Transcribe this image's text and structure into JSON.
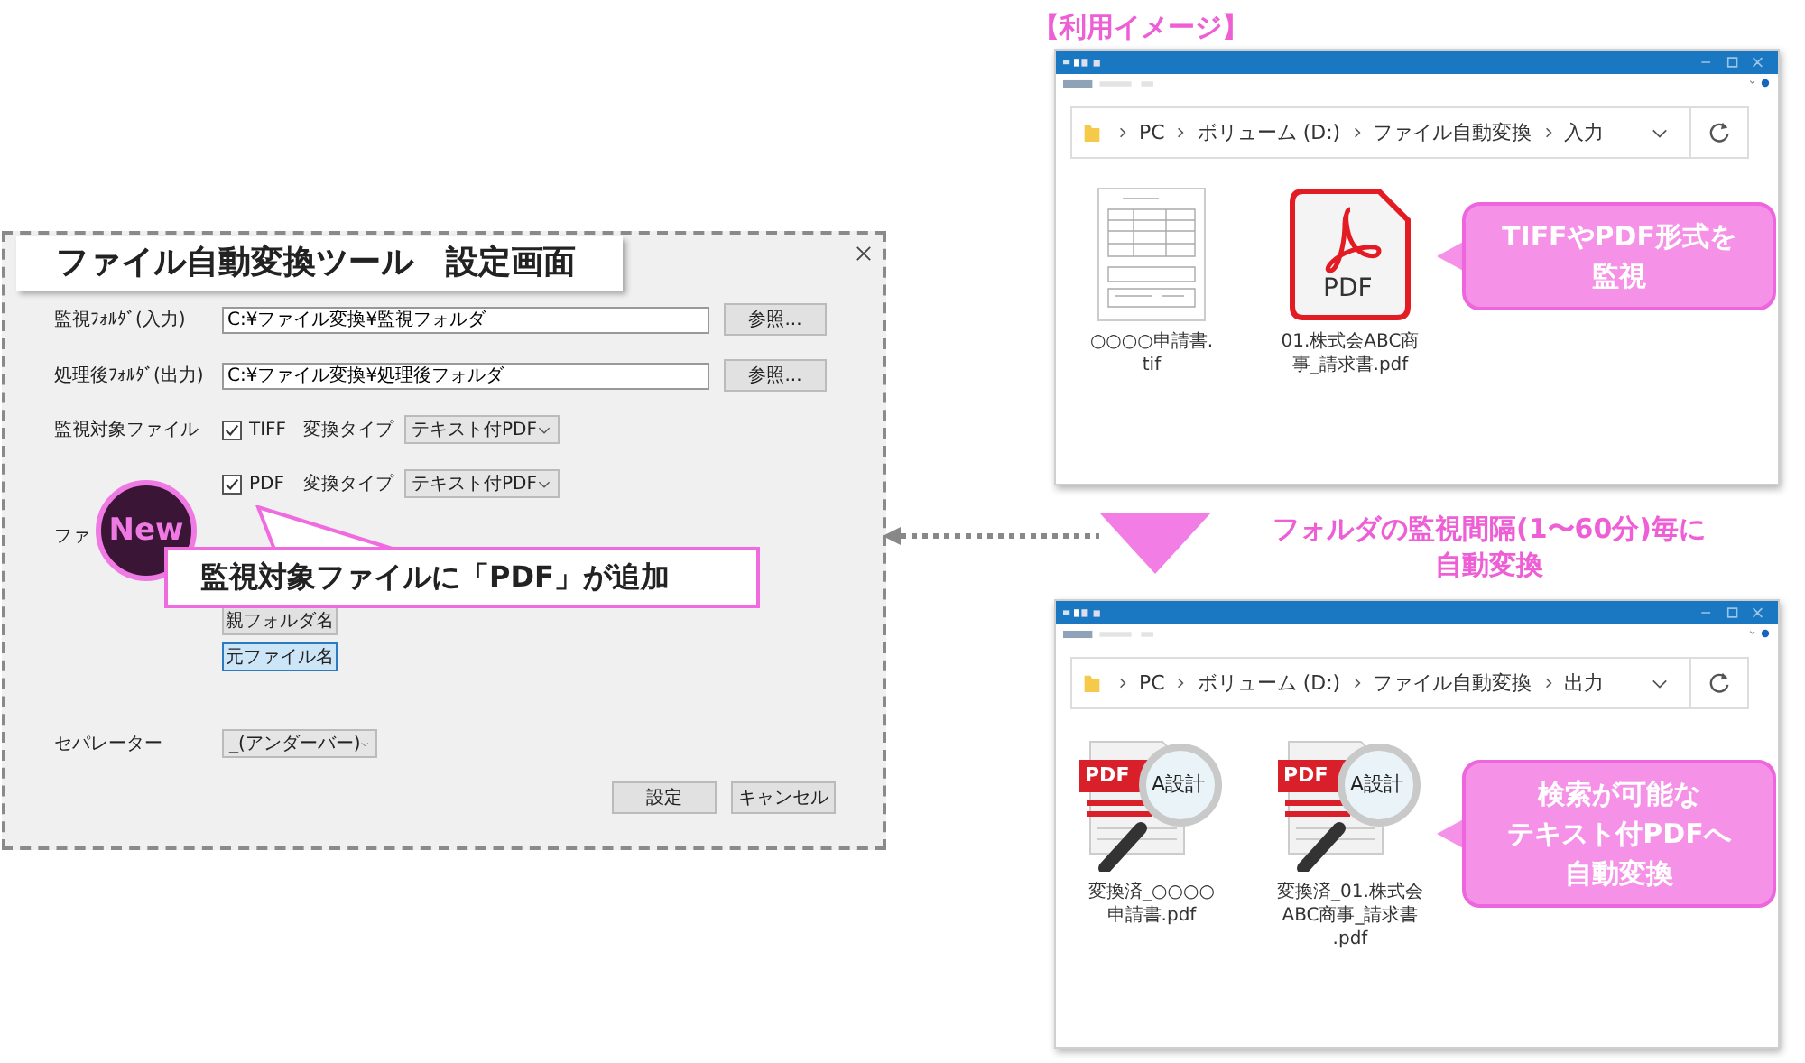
{
  "dialog": {
    "title": "ファイル自動変換ツール　設定画面",
    "input_folder": {
      "label": "監視ﾌｫﾙﾀﾞ(入力)",
      "value": "C:¥ファイル変換¥監視フォルダ",
      "button": "参照..."
    },
    "output_folder": {
      "label": "処理後ﾌｫﾙﾀﾞ(出力)",
      "value": "C:¥ファイル変換¥処理後フォルダ",
      "button": "参照..."
    },
    "target_files": {
      "label": "監視対象ファイル",
      "items": [
        {
          "name": "TIFF",
          "checked": true,
          "type_label": "変換タイプ",
          "type_value": "テキスト付PDF"
        },
        {
          "name": "PDF",
          "checked": true,
          "type_label": "変換タイプ",
          "type_value": "テキスト付PDF"
        }
      ]
    },
    "filename_label": "ファ",
    "name_buttons": [
      {
        "label": "親フォルダ名",
        "selected": false
      },
      {
        "label": "元ファイル名",
        "selected": true
      }
    ],
    "separator": {
      "label": "セパレーター",
      "value": "_(アンダーバー)"
    },
    "buttons": [
      "設定",
      "キャンセル"
    ]
  },
  "new_badge": "New",
  "callout": "監視対象ファイルに「PDF」が追加",
  "usage_title": "【利用イメージ】",
  "input_window": {
    "path": [
      "PC",
      "ボリューム (D:)",
      "ファイル自動変換",
      "入力"
    ],
    "files": [
      {
        "kind": "tif",
        "name": [
          "○○○○申請書.",
          "tif"
        ]
      },
      {
        "kind": "pdf",
        "icon_text": "PDF",
        "name": [
          "01.株式会ABC商",
          "事_請求書.pdf"
        ]
      }
    ],
    "callout": [
      "TIFFやPDF形式を",
      "監視"
    ]
  },
  "interval_note": [
    "フォルダの監視間隔(1〜60分)毎に",
    "自動変換"
  ],
  "output_window": {
    "path": [
      "PC",
      "ボリューム (D:)",
      "ファイル自動変換",
      "出力"
    ],
    "files": [
      {
        "kind": "searchable",
        "badge": "PDF",
        "lens_text": "A設計",
        "name": [
          "変換済_○○○○",
          "申請書.pdf"
        ]
      },
      {
        "kind": "searchable",
        "badge": "PDF",
        "lens_text": "A設計",
        "name": [
          "変換済_01.株式会",
          "ABC商事_請求書",
          ".pdf"
        ]
      }
    ],
    "callout": [
      "検索が可能な",
      "テキスト付PDFへ",
      "自動変換"
    ]
  }
}
